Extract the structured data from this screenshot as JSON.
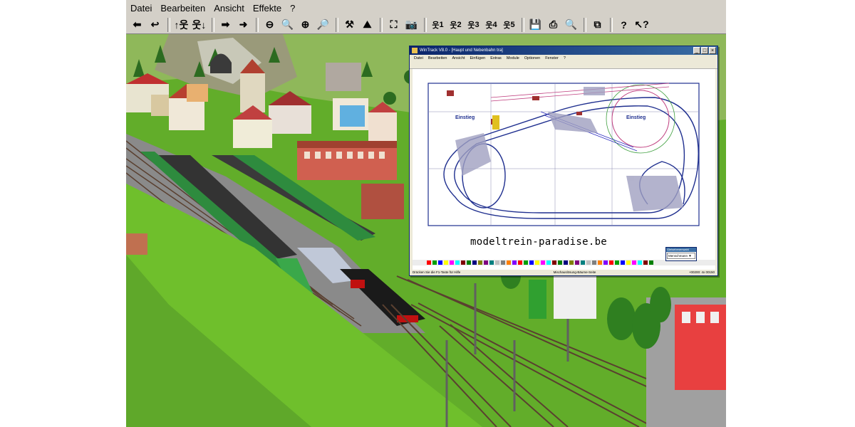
{
  "menubar": {
    "items": [
      {
        "label": "Datei"
      },
      {
        "label": "Bearbeiten"
      },
      {
        "label": "Ansicht"
      },
      {
        "label": "Effekte"
      },
      {
        "label": "?"
      }
    ]
  },
  "toolbar": {
    "buttons": [
      {
        "icon": "arrow-left-icon",
        "glyph": "⬅"
      },
      {
        "icon": "arrow-back-icon",
        "glyph": "↩"
      },
      {
        "icon": "figure-up-icon",
        "glyph": "↑웃"
      },
      {
        "icon": "figure-down-icon",
        "glyph": "웃↓"
      },
      {
        "icon": "arrow-forward-icon",
        "glyph": "➡"
      },
      {
        "icon": "arrow-right-icon",
        "glyph": "➜"
      },
      {
        "icon": "zoom-out-full-icon",
        "glyph": "⊖"
      },
      {
        "icon": "zoom-out-icon",
        "glyph": "🔍"
      },
      {
        "icon": "zoom-in-icon",
        "glyph": "⊕"
      },
      {
        "icon": "zoom-in-full-icon",
        "glyph": "🔎"
      },
      {
        "icon": "track-icon",
        "glyph": "⚒"
      },
      {
        "icon": "tunnel-icon",
        "glyph": "⛰"
      },
      {
        "icon": "fit-view-icon",
        "glyph": "⛶"
      },
      {
        "icon": "camera-icon",
        "glyph": "📷"
      },
      {
        "icon": "camera-1-icon",
        "glyph": "웃",
        "num": "1"
      },
      {
        "icon": "camera-2-icon",
        "glyph": "웃",
        "num": "2"
      },
      {
        "icon": "camera-3-icon",
        "glyph": "웃",
        "num": "3"
      },
      {
        "icon": "camera-4-icon",
        "glyph": "웃",
        "num": "4"
      },
      {
        "icon": "camera-5-icon",
        "glyph": "웃",
        "num": "5"
      },
      {
        "icon": "save-icon",
        "glyph": "💾"
      },
      {
        "icon": "print-icon",
        "glyph": "⎙"
      },
      {
        "icon": "print-preview-icon",
        "glyph": "🔍"
      },
      {
        "icon": "copy-icon",
        "glyph": "⧉"
      },
      {
        "icon": "help-icon",
        "glyph": "?"
      },
      {
        "icon": "context-help-icon",
        "glyph": "↖?"
      }
    ]
  },
  "inset": {
    "title": "WinTrack V8.0 - [Haupt und Nebenbahn tra]",
    "menu": [
      "Datei",
      "Bearbeiten",
      "Ansicht",
      "Einfügen",
      "Extras",
      "Module",
      "Optionen",
      "Fenster",
      "?"
    ],
    "labels": {
      "left": "Einstieg",
      "right": "Einstieg"
    },
    "status_left": "Drücken Sie die F1-Taste für Hilfe",
    "status_mid": "Mischauslösung-Bäume-Seite",
    "status_right": "+00200: 4x 00150",
    "layer_box": {
      "header": "Gleisebenenwahl",
      "value": "Menschmann ▼"
    },
    "colors": {
      "title_start": "#0a246a",
      "title_end": "#3a6ea5",
      "track": "#1f2f8f"
    }
  },
  "watermark": "modeltrein-paradise.be",
  "colors": {
    "grass": "#6fb92d",
    "ballast": "#8a8a8a",
    "rail": "#5a4030",
    "sky": "#4aa0d0"
  }
}
